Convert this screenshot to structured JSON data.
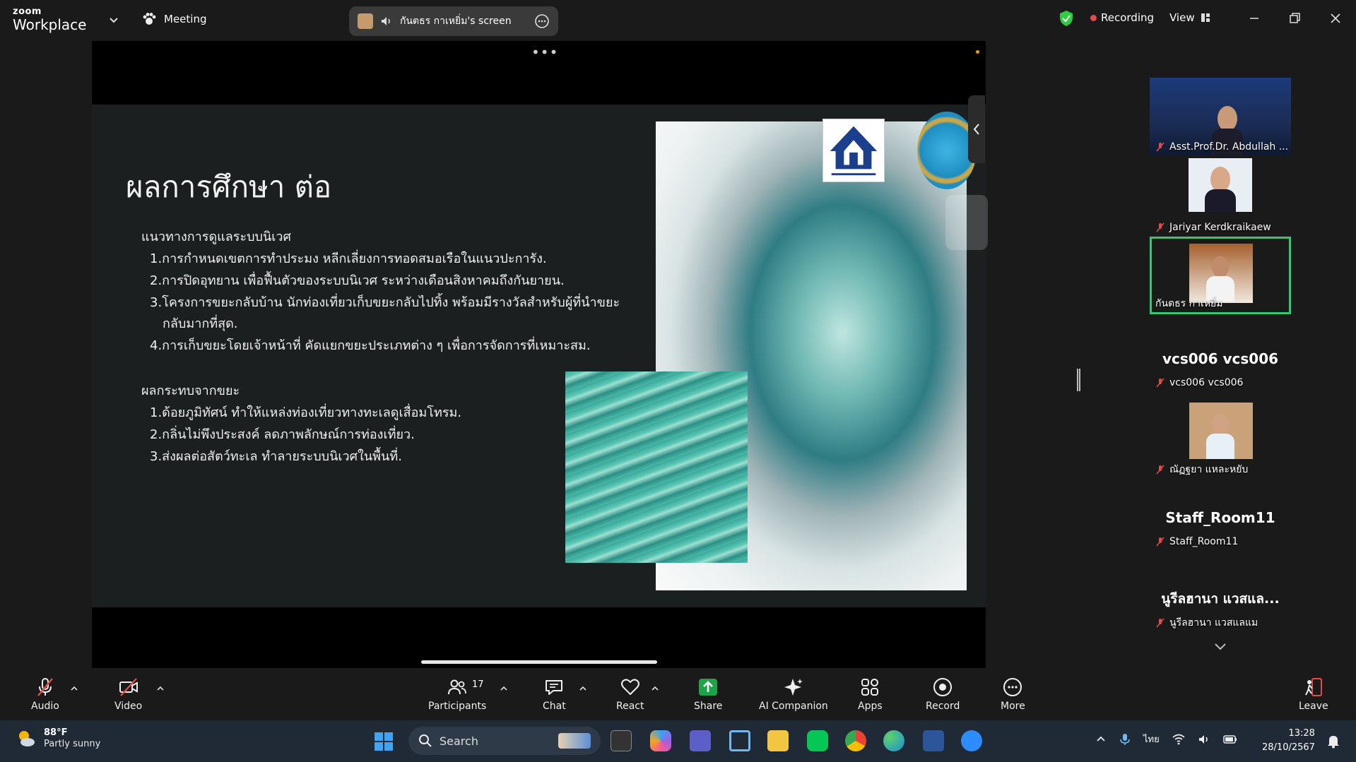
{
  "topbar": {
    "brand_small": "zoom",
    "brand_big": "Workplace",
    "meeting_label": "Meeting",
    "share_label": "กันตธร กาเหยิ่ม's screen",
    "recording_label": "Recording",
    "view_label": "View"
  },
  "slide": {
    "title": "ผลการศึกษา ต่อ",
    "section1": {
      "heading": "แนวทางการดูแลระบบนิเวศ",
      "items": [
        "1.การกำหนดเขตการทำประมง หลีกเลี่ยงการทอดสมอเรือในแนวปะการัง.",
        "2.การปิดอุทยาน เพื่อฟื้นตัวของระบบนิเวศ ระหว่างเดือนสิงหาคมถึงกันยายน.",
        "3.โครงการขยะกลับบ้าน นักท่องเที่ยวเก็บขยะกลับไปทิ้ง พร้อมมีรางวัลสำหรับผู้ที่นำขยะ",
        "กลับมากที่สุด.",
        "4.การเก็บขยะโดยเจ้าหน้าที่ คัดแยกขยะประเภทต่าง ๆ เพื่อการจัดการที่เหมาะสม."
      ]
    },
    "section2": {
      "heading": "ผลกระทบจากขยะ",
      "items": [
        "1.ด้อยภูมิทัศน์ ทำให้แหล่งท่องเที่ยวทางทะเลดูเสื่อมโทรม.",
        "2.กลิ่นไม่พึงประสงค์ ลดภาพลักษณ์การท่องเที่ยว.",
        "3.ส่งผลต่อสัตว์ทะเล ทำลายระบบนิเวศในพื้นที่."
      ]
    }
  },
  "participants": {
    "tiles": [
      {
        "name": "Asst.Prof.Dr. Abdullah ...",
        "big": "",
        "video": true,
        "active": false
      },
      {
        "name": "Jariyar Kerdkraikaew",
        "big": "",
        "video": true,
        "active": false
      },
      {
        "name": "กันตธร กาเหยิ่ม",
        "big": "",
        "video": true,
        "active": true
      },
      {
        "name": "vcs006 vcs006",
        "big": "vcs006 vcs006",
        "video": false,
        "active": false
      },
      {
        "name": "ณัฏฐยา แหละหยับ",
        "big": "",
        "video": true,
        "active": false
      },
      {
        "name": "Staff_Room11",
        "big": "Staff_Room11",
        "video": false,
        "active": false
      },
      {
        "name": "นูรีลฮานา แวสแลแม",
        "big": "นูรีลฮานา แวสแล...",
        "video": false,
        "active": false
      }
    ]
  },
  "toolbar": {
    "audio": "Audio",
    "video": "Video",
    "participants": "Participants",
    "participants_count": "17",
    "chat": "Chat",
    "react": "React",
    "share": "Share",
    "ai_companion": "AI Companion",
    "apps": "Apps",
    "record": "Record",
    "more": "More",
    "leave": "Leave"
  },
  "taskbar": {
    "temperature": "88°F",
    "condition": "Partly sunny",
    "search_placeholder": "Search",
    "language": "ไทย",
    "time": "13:28",
    "date": "28/10/2567"
  },
  "colors": {
    "accent_green": "#2ecc71",
    "share_green": "#1fa34a",
    "recording_red": "#e34b4b",
    "leave_red": "#e34b4b"
  }
}
